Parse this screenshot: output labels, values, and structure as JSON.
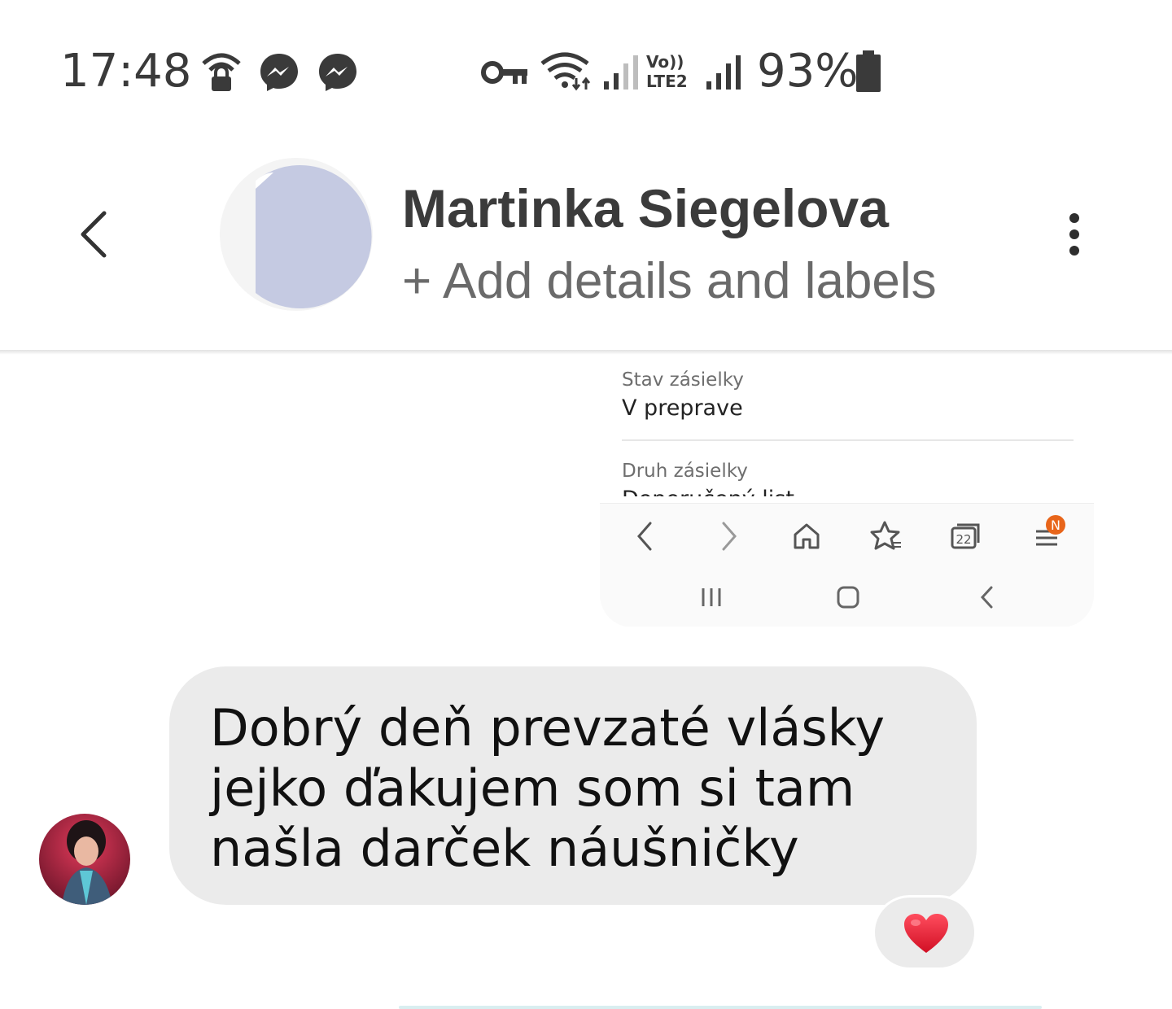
{
  "status_bar": {
    "time": "17:48",
    "battery": "93%",
    "network_label": "Vo))\nLTE2",
    "icons": [
      "wifi-lock-icon",
      "messenger-icon",
      "messenger-icon",
      "vpn-key-icon",
      "wifi-icon",
      "signal-icon",
      "volte-icon",
      "signal-icon",
      "battery-icon"
    ]
  },
  "header": {
    "back_icon": "chevron-left-icon",
    "contact_name": "Martinka Siegelova",
    "subtitle": "+ Add details and labels",
    "menu_icon": "more-vertical-icon"
  },
  "shared_image": {
    "fields": [
      {
        "label": "Stav zásielky",
        "value": "V preprave"
      },
      {
        "label": "Druh zásielky",
        "value": "Doporučený list"
      }
    ],
    "browser_toolbar": {
      "icons": [
        "back-icon",
        "forward-icon",
        "home-icon",
        "bookmarks-icon",
        "tabs-icon",
        "menu-icon"
      ],
      "tabs_count": "22",
      "notification_badge": "N"
    },
    "system_nav_icons": [
      "recents-icon",
      "home-icon",
      "back-icon"
    ]
  },
  "message": {
    "text": "Dobrý deň prevzaté vlásky jejko ďakujem som si tam našla darček náušničky",
    "reaction": "❤️"
  },
  "colors": {
    "bubble": "#ebebeb",
    "avatar_placeholder": "#c5cae2",
    "badge": "#e8651a",
    "heart": "#e0162b"
  }
}
